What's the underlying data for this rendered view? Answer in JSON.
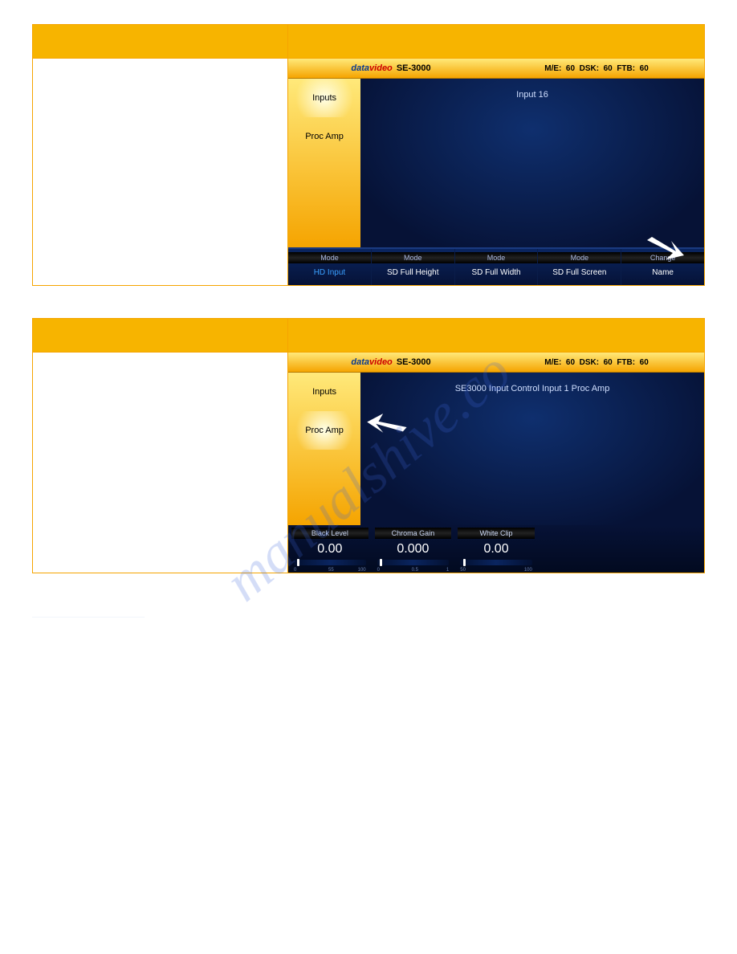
{
  "watermark": "manualshive.co",
  "screen1": {
    "logo": {
      "data": "data",
      "video": "video",
      "model": "SE-3000"
    },
    "status": {
      "me": "M/E:",
      "me_v": "60",
      "dsk": "DSK:",
      "dsk_v": "60",
      "ftb": "FTB:",
      "ftb_v": "60"
    },
    "sidebar": {
      "inputs": "Inputs",
      "procamp": "Proc Amp"
    },
    "main_title": "Input 16",
    "bottom": [
      {
        "label": "Mode",
        "value": "HD Input",
        "active": true
      },
      {
        "label": "Mode",
        "value": "SD Full Height"
      },
      {
        "label": "Mode",
        "value": "SD Full Width"
      },
      {
        "label": "Mode",
        "value": "SD Full Screen"
      },
      {
        "label": "Change",
        "value": "Name"
      }
    ]
  },
  "screen2": {
    "logo": {
      "data": "data",
      "video": "video",
      "model": "SE-3000"
    },
    "status": {
      "me": "M/E:",
      "me_v": "60",
      "dsk": "DSK:",
      "dsk_v": "60",
      "ftb": "FTB:",
      "ftb_v": "60"
    },
    "sidebar": {
      "inputs": "Inputs",
      "procamp": "Proc Amp"
    },
    "main_title": "SE3000 Input Control Input 1 Proc Amp",
    "proc": [
      {
        "label": "Black Level",
        "value": "0.00",
        "min": "0",
        "mid": "55",
        "max": "100"
      },
      {
        "label": "Chroma Gain",
        "value": "0.000",
        "min": "0",
        "mid": "0.5",
        "max": "1"
      },
      {
        "label": "White Clip",
        "value": "0.00",
        "min": "50",
        "mid": "",
        "max": "100"
      }
    ]
  }
}
